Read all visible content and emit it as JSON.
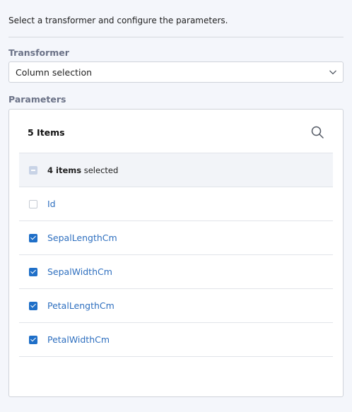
{
  "instruction": "Select a transformer and configure the parameters.",
  "transformer": {
    "label": "Transformer",
    "value": "Column selection",
    "icon": "chevron-down-icon"
  },
  "parameters": {
    "label": "Parameters",
    "count_label": "5 Items",
    "search_icon": "search-icon",
    "select_all": {
      "count": "4 items",
      "suffix": " selected",
      "state": "indeterminate"
    },
    "items": [
      {
        "name": "Id",
        "checked": false
      },
      {
        "name": "SepalLengthCm",
        "checked": true
      },
      {
        "name": "SepalWidthCm",
        "checked": true
      },
      {
        "name": "PetalLengthCm",
        "checked": true
      },
      {
        "name": "PetalWidthCm",
        "checked": true
      }
    ]
  },
  "colors": {
    "accent": "#1f6fc8",
    "link": "#2e6fbf",
    "label": "#6b7287"
  }
}
